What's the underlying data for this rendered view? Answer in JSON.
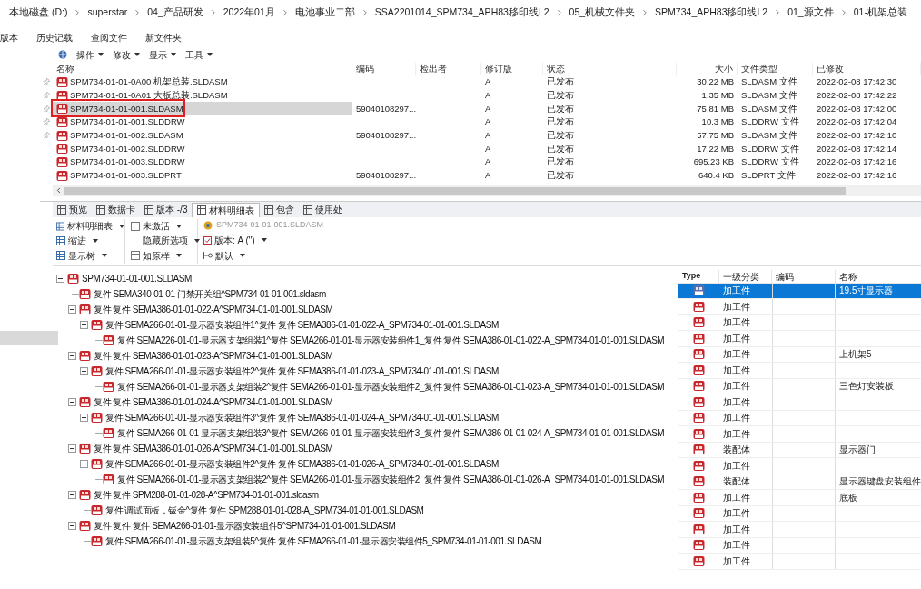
{
  "breadcrumb": [
    "本地磁盘 (D:)",
    "superstar",
    "04_产品研发",
    "2022年01月",
    "电池事业二部",
    "SSA2201014_SPM734_APH83移印线L2",
    "05_机械文件夹",
    "SPM734_APH83移印线L2",
    "01_源文件",
    "01-机架总装"
  ],
  "menu_tabs": [
    "版本",
    "历史记载",
    "查阅文件",
    "新文件夹"
  ],
  "toolbar": [
    "操作",
    "修改",
    "显示",
    "工具"
  ],
  "files": {
    "columns": [
      "名称",
      "编码",
      "检出者",
      "修订版",
      "状态",
      "大小",
      "文件类型",
      "已修改"
    ],
    "rows": [
      {
        "name": "SPM734-01-01-0A00 机架总装.SLDASM",
        "code": "",
        "revision": "A",
        "status": "已发布",
        "size": "30.22 MB",
        "type": "SLDASM 文件",
        "modified": "2022-02-08 17:42:30",
        "pinned": true,
        "selected": false,
        "marked": false
      },
      {
        "name": "SPM734-01-01-0A01 大板总装.SLDASM",
        "code": "",
        "revision": "A",
        "status": "已发布",
        "size": "1.35 MB",
        "type": "SLDASM 文件",
        "modified": "2022-02-08 17:42:22",
        "pinned": true,
        "selected": false,
        "marked": false
      },
      {
        "name": "SPM734-01-01-001.SLDASM",
        "code": "59040108297...",
        "revision": "A",
        "status": "已发布",
        "size": "75.81 MB",
        "type": "SLDASM 文件",
        "modified": "2022-02-08 17:42:00",
        "pinned": true,
        "selected": true,
        "marked": true
      },
      {
        "name": "SPM734-01-01-001.SLDDRW",
        "code": "",
        "revision": "A",
        "status": "已发布",
        "size": "10.3 MB",
        "type": "SLDDRW 文件",
        "modified": "2022-02-08 17:42:04",
        "pinned": true,
        "selected": false,
        "marked": false
      },
      {
        "name": "SPM734-01-01-002.SLDASM",
        "code": "59040108297...",
        "revision": "A",
        "status": "已发布",
        "size": "57.75 MB",
        "type": "SLDASM 文件",
        "modified": "2022-02-08 17:42:10",
        "pinned": true,
        "selected": false,
        "marked": false
      },
      {
        "name": "SPM734-01-01-002.SLDDRW",
        "code": "",
        "revision": "A",
        "status": "已发布",
        "size": "17.22 MB",
        "type": "SLDDRW 文件",
        "modified": "2022-02-08 17:42:14",
        "pinned": false,
        "selected": false,
        "marked": false
      },
      {
        "name": "SPM734-01-01-003.SLDDRW",
        "code": "",
        "revision": "A",
        "status": "已发布",
        "size": "695.23 KB",
        "type": "SLDDRW 文件",
        "modified": "2022-02-08 17:42:16",
        "pinned": false,
        "selected": false,
        "marked": false
      },
      {
        "name": "SPM734-01-01-003.SLDPRT",
        "code": "59040108297...",
        "revision": "A",
        "status": "已发布",
        "size": "640.4 KB",
        "type": "SLDPRT 文件",
        "modified": "2022-02-08 17:42:16",
        "pinned": false,
        "selected": false,
        "marked": false
      }
    ]
  },
  "tabs": [
    {
      "label": "预览",
      "selected": false
    },
    {
      "label": "数据卡",
      "selected": false
    },
    {
      "label": "版本 -/3",
      "selected": false
    },
    {
      "label": "材料明细表",
      "selected": true
    },
    {
      "label": "包含",
      "selected": false
    },
    {
      "label": "使用处",
      "selected": false
    }
  ],
  "ribbon": {
    "col1": [
      "材料明细表",
      "缩进",
      "显示树"
    ],
    "col2": [
      "未激活",
      "隐藏所选项",
      "如原样"
    ],
    "file": "SPM734-01-01-001.SLDASM",
    "version": "版本: A (\")",
    "version_checked": true,
    "config": "默认"
  },
  "tree": {
    "text": "SPM734-01-01-001.SLDASM",
    "expanded": true,
    "children": [
      {
        "text": "复件 SEMA340-01-01-门禁开关组^SPM734-01-01-001.sldasm"
      },
      {
        "text": "复件 复件 SEMA386-01-01-022-A^SPM734-01-01-001.SLDASM",
        "expanded": true,
        "children": [
          {
            "text": "复件 SEMA266-01-01-显示器安装组件1^复件 复件 SEMA386-01-01-022-A_SPM734-01-01-001.SLDASM",
            "expanded": true,
            "children": [
              {
                "text": "复件 SEMA226-01-01-显示器支架组装1^复件 SEMA266-01-01-显示器安装组件1_复件 复件 SEMA386-01-01-022-A_SPM734-01-01-001.SLDASM"
              }
            ]
          }
        ]
      },
      {
        "text": "复件 复件 SEMA386-01-01-023-A^SPM734-01-01-001.SLDASM",
        "expanded": true,
        "children": [
          {
            "text": "复件 SEMA266-01-01-显示器安装组件2^复件 复件 SEMA386-01-01-023-A_SPM734-01-01-001.SLDASM",
            "expanded": true,
            "children": [
              {
                "text": "复件 SEMA266-01-01-显示器支架组装2^复件 SEMA266-01-01-显示器安装组件2_复件 复件 SEMA386-01-01-023-A_SPM734-01-01-001.SLDASM"
              }
            ]
          }
        ]
      },
      {
        "text": "复件 复件 SEMA386-01-01-024-A^SPM734-01-01-001.SLDASM",
        "expanded": true,
        "children": [
          {
            "text": "复件 SEMA266-01-01-显示器安装组件3^复件 复件 SEMA386-01-01-024-A_SPM734-01-01-001.SLDASM",
            "expanded": true,
            "children": [
              {
                "text": "复件 SEMA266-01-01-显示器支架组装3^复件 SEMA266-01-01-显示器安装组件3_复件 复件 SEMA386-01-01-024-A_SPM734-01-01-001.SLDASM"
              }
            ]
          }
        ]
      },
      {
        "text": "复件 复件 SEMA386-01-01-026-A^SPM734-01-01-001.SLDASM",
        "expanded": true,
        "children": [
          {
            "text": "复件 SEMA266-01-01-显示器安装组件2^复件 复件 SEMA386-01-01-026-A_SPM734-01-01-001.SLDASM",
            "expanded": true,
            "children": [
              {
                "text": "复件 SEMA266-01-01-显示器支架组装2^复件 SEMA266-01-01-显示器安装组件2_复件 复件 SEMA386-01-01-026-A_SPM734-01-01-001.SLDASM"
              }
            ]
          }
        ]
      },
      {
        "text": "复件 复件 SPM288-01-01-028-A^SPM734-01-01-001.sldasm",
        "expanded": true,
        "children": [
          {
            "text": "复件 调试面板，钣金^复件 复件 SPM288-01-01-028-A_SPM734-01-01-001.SLDASM"
          }
        ]
      },
      {
        "text": "复件 复件 复件 SEMA266-01-01-显示器安装组件5^SPM734-01-01-001.SLDASM",
        "expanded": true,
        "children": [
          {
            "text": "复件 SEMA266-01-01-显示器支架组装5^复件 复件 SEMA266-01-01-显示器安装组件5_SPM734-01-01-001.SLDASM"
          }
        ]
      }
    ]
  },
  "bom": {
    "columns": [
      "Type",
      "一级分类",
      "编码",
      "名称"
    ],
    "rows": [
      {
        "category": "加工件",
        "name": "19.5寸显示器",
        "selected": true
      },
      {
        "category": "加工件",
        "selected": false
      },
      {
        "category": "加工件",
        "selected": false
      },
      {
        "category": "加工件",
        "selected": false
      },
      {
        "category": "加工件",
        "name": "上机架5",
        "selected": false
      },
      {
        "category": "加工件",
        "selected": false
      },
      {
        "category": "加工件",
        "name": "三色灯安装板",
        "selected": false
      },
      {
        "category": "加工件",
        "selected": false
      },
      {
        "category": "加工件",
        "selected": false
      },
      {
        "category": "加工件",
        "selected": false
      },
      {
        "category": "装配体",
        "name": "显示器门",
        "selected": false
      },
      {
        "category": "加工件",
        "selected": false
      },
      {
        "category": "装配体",
        "name": "显示器键盘安装组件",
        "selected": false
      },
      {
        "category": "加工件",
        "name": "底板",
        "selected": false
      },
      {
        "category": "加工件",
        "selected": false
      },
      {
        "category": "加工件",
        "selected": false
      },
      {
        "category": "加工件",
        "selected": false
      },
      {
        "category": "加工件",
        "selected": false
      }
    ]
  }
}
